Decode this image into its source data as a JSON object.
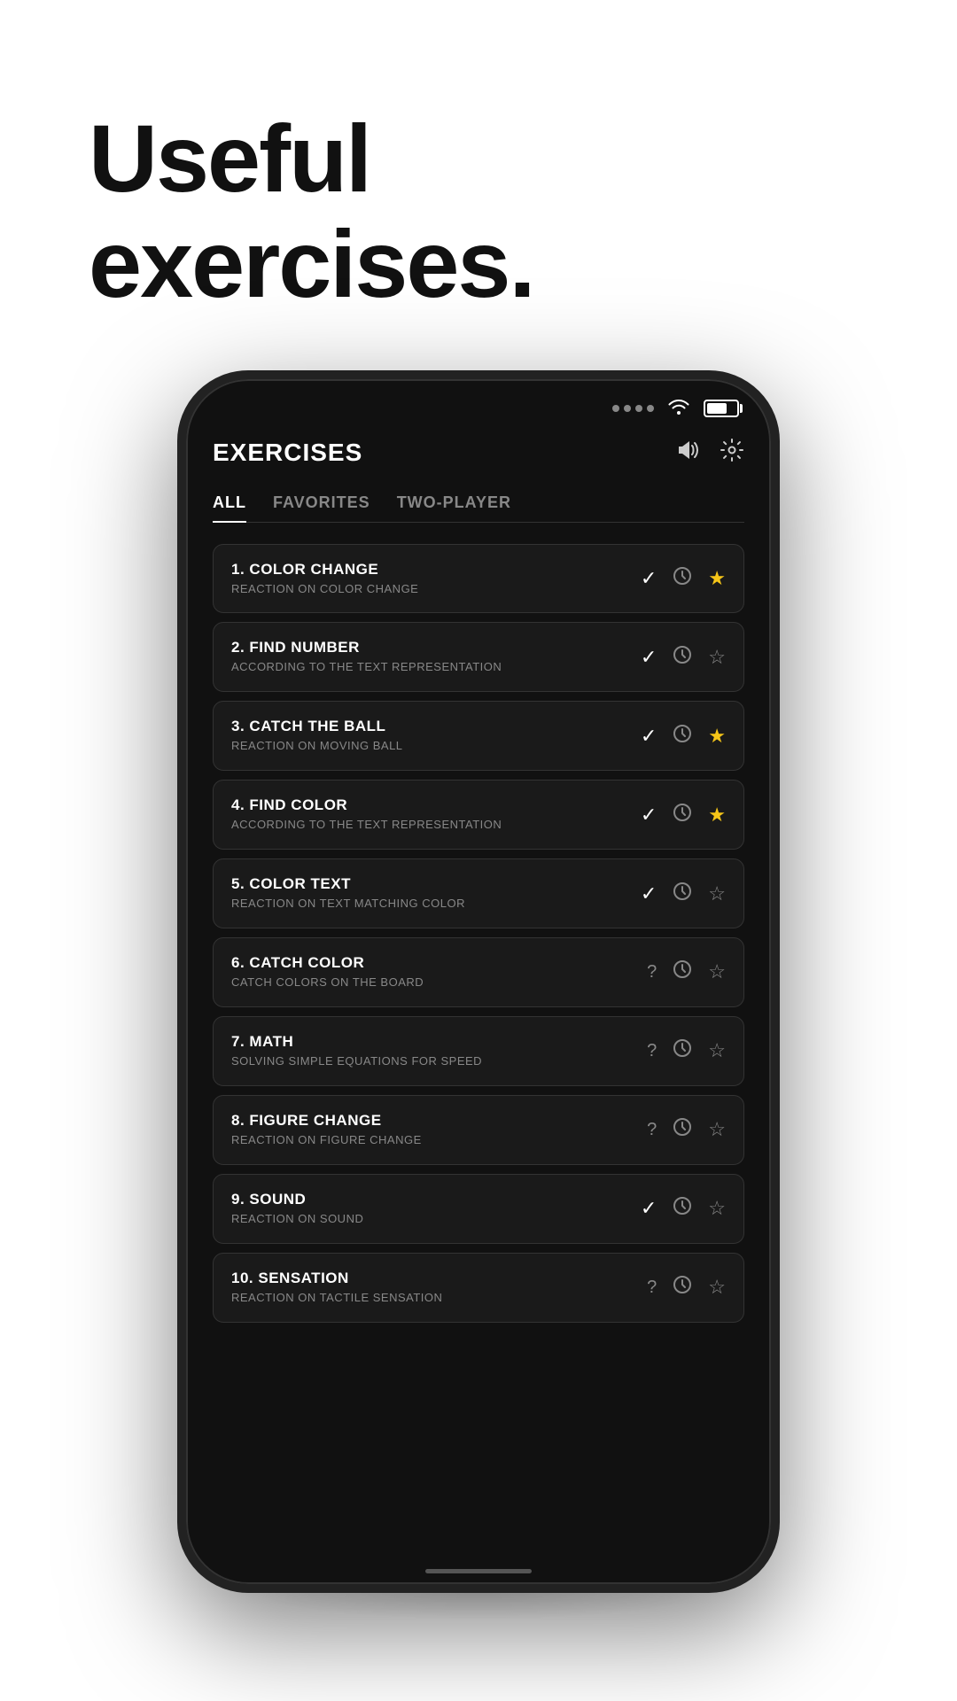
{
  "header": {
    "title_line1": "Useful",
    "title_line2": "exercises."
  },
  "app": {
    "title": "EXERCISES",
    "sound_icon": "🔊",
    "settings_icon": "⚙",
    "tabs": [
      {
        "label": "ALL",
        "active": true
      },
      {
        "label": "FAVORITES",
        "active": false
      },
      {
        "label": "TWO-PLAYER",
        "active": false
      }
    ],
    "exercises": [
      {
        "number": "1.",
        "name": "COLOR CHANGE",
        "description": "REACTION ON COLOR CHANGE",
        "status": "check",
        "favorited": true
      },
      {
        "number": "2.",
        "name": "FIND NUMBER",
        "description": "ACCORDING TO THE TEXT REPRESENTATION",
        "status": "check",
        "favorited": false
      },
      {
        "number": "3.",
        "name": "CATCH THE BALL",
        "description": "REACTION ON MOVING BALL",
        "status": "check",
        "favorited": true
      },
      {
        "number": "4.",
        "name": "FIND COLOR",
        "description": "ACCORDING TO THE TEXT REPRESENTATION",
        "status": "check",
        "favorited": true
      },
      {
        "number": "5.",
        "name": "COLOR TEXT",
        "description": "REACTION ON TEXT MATCHING COLOR",
        "status": "check",
        "favorited": false
      },
      {
        "number": "6.",
        "name": "CATCH COLOR",
        "description": "CATCH COLORS ON THE BOARD",
        "status": "question",
        "favorited": false
      },
      {
        "number": "7.",
        "name": "MATH",
        "description": "SOLVING SIMPLE EQUATIONS FOR SPEED",
        "status": "question",
        "favorited": false
      },
      {
        "number": "8.",
        "name": "FIGURE CHANGE",
        "description": "REACTION ON FIGURE CHANGE",
        "status": "question",
        "favorited": false
      },
      {
        "number": "9.",
        "name": "SOUND",
        "description": "REACTION ON SOUND",
        "status": "check",
        "favorited": false
      },
      {
        "number": "10.",
        "name": "SENSATION",
        "description": "REACTION ON TACTILE SENSATION",
        "status": "question",
        "favorited": false
      }
    ]
  }
}
